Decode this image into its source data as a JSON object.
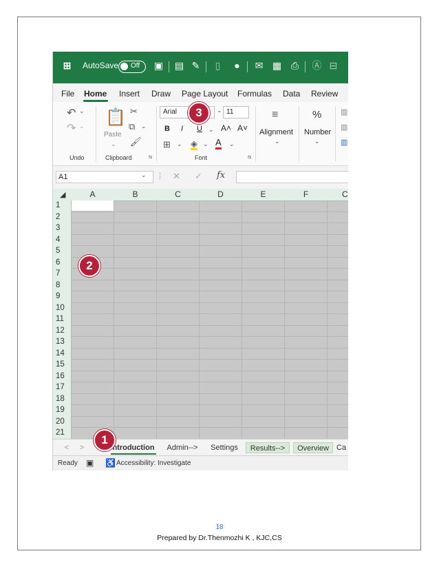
{
  "titlebar": {
    "app_icon": "excel-logo-icon",
    "autosave_label": "AutoSave",
    "autosave_state": "Off",
    "quick_icons": [
      "save-icon",
      "form-icon",
      "brush-icon",
      "page-icon",
      "record-icon",
      "sign-icon",
      "scan-icon",
      "print-icon",
      "circle-a-icon",
      "layout-icon"
    ]
  },
  "menu": {
    "tabs": [
      "File",
      "Home",
      "Insert",
      "Draw",
      "Page Layout",
      "Formulas",
      "Data",
      "Review"
    ],
    "active": "Home"
  },
  "ribbon": {
    "undo_label": "Undo",
    "clipboard_label": "Clipboard",
    "paste_label": "Paste",
    "font_label": "Font",
    "font_name": "Arial",
    "font_size": "11",
    "bold": "B",
    "italic": "I",
    "underline": "U",
    "grow_font": "A˄",
    "shrink_font": "A˅",
    "alignment_label": "Alignment",
    "number_label": "Number",
    "number_glyph": "%"
  },
  "formula_bar": {
    "name_box": "A1",
    "fx": "fx"
  },
  "grid": {
    "columns": [
      "A",
      "B",
      "C",
      "D",
      "E",
      "F",
      "C"
    ],
    "rows": [
      "1",
      "2",
      "3",
      "4",
      "5",
      "6",
      "7",
      "8",
      "9",
      "10",
      "11",
      "12",
      "13",
      "14",
      "15",
      "16",
      "17",
      "18",
      "19",
      "20",
      "21"
    ]
  },
  "sheet_tabs": {
    "nav_prev": "<",
    "nav_next": ">",
    "tabs": [
      "ntroduction",
      "Admin-->",
      "Settings",
      "Results-->",
      "Overview",
      "Ca"
    ]
  },
  "status": {
    "ready": "Ready",
    "accessibility": "Accessibility: Investigate"
  },
  "callouts": {
    "one": "1",
    "two": "2",
    "three": "3"
  },
  "footer": {
    "page_number": "18",
    "prepared_by": "Prepared by  Dr.Thenmozhi K , KJC,CS"
  },
  "colors": {
    "excel_green": "#1f7a43",
    "callout_red": "#b5213a",
    "grid_gray": "#c8c8c8"
  }
}
